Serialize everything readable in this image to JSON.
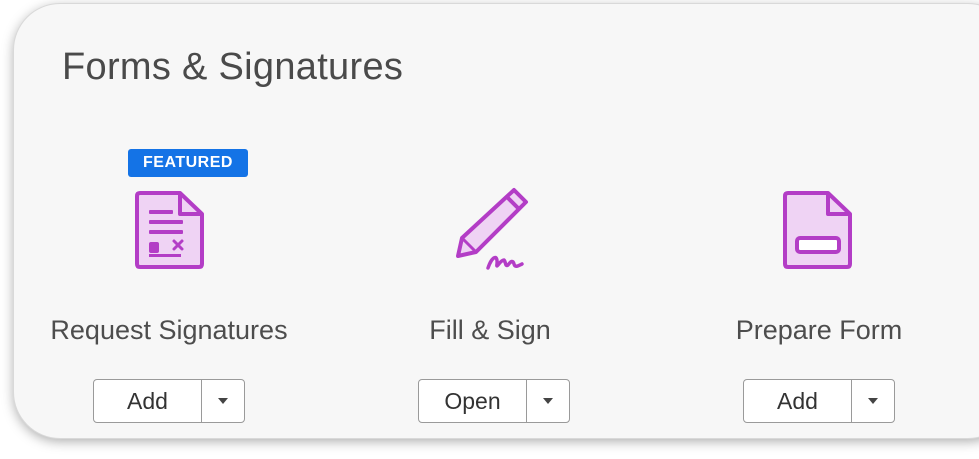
{
  "panel": {
    "title": "Forms & Signatures"
  },
  "colors": {
    "tool_accent": "#b33dc6",
    "badge": "#1473e6"
  },
  "tools": [
    {
      "name": "Request Signatures",
      "icon": "request-signatures-icon",
      "badge": "FEATURED",
      "button_label": "Add",
      "has_dropdown": true
    },
    {
      "name": "Fill & Sign",
      "icon": "fill-sign-pen-icon",
      "button_label": "Open",
      "has_dropdown": true
    },
    {
      "name": "Prepare Form",
      "icon": "prepare-form-icon",
      "button_label": "Add",
      "has_dropdown": true
    }
  ]
}
